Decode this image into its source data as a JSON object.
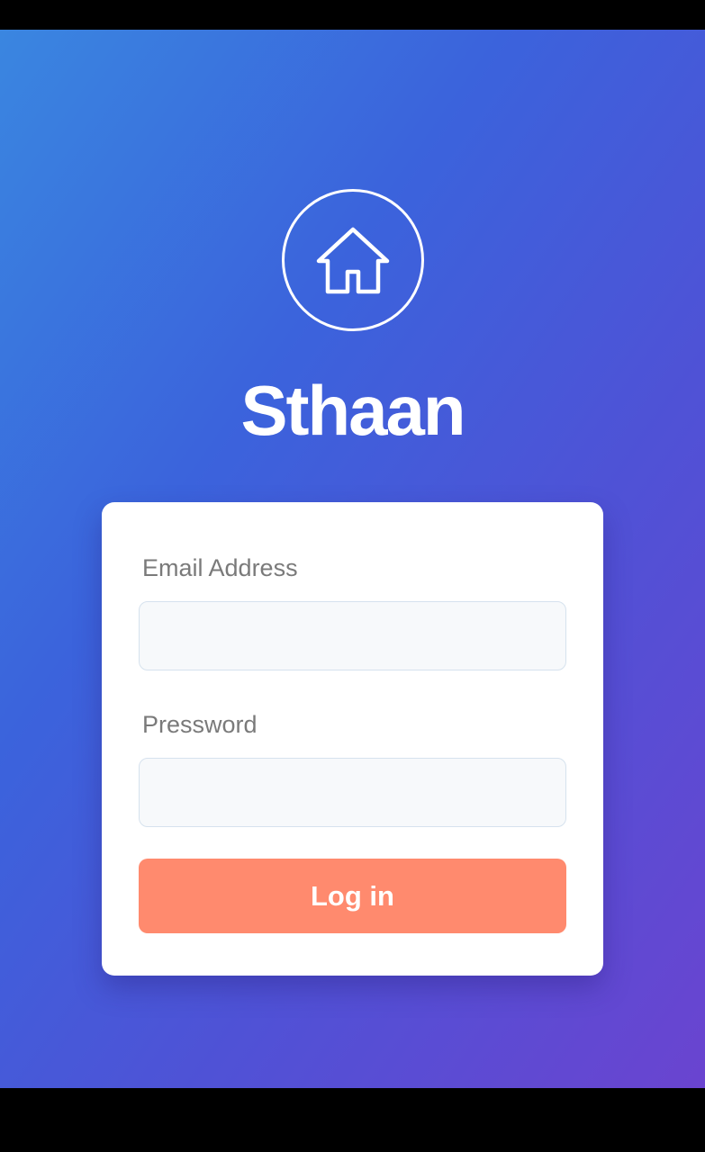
{
  "app": {
    "name": "Sthaan",
    "logo_icon": "house-icon"
  },
  "login_form": {
    "email_label": "Email Address",
    "email_value": "",
    "password_label": "Pressword",
    "password_value": "",
    "submit_label": "Log in"
  },
  "colors": {
    "gradient_start": "#3a86e0",
    "gradient_end": "#6a44d0",
    "button": "#ff8a6e",
    "card": "#ffffff"
  }
}
